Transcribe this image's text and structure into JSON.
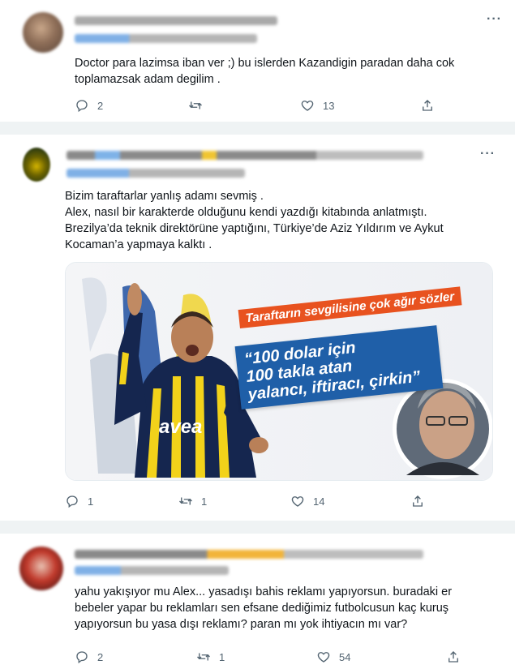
{
  "tweets": [
    {
      "text": "Doctor para lazimsa iban ver ;) bu islerden Kazandigin paradan daha cok\ntoplamazsak adam degilim .",
      "replies": "2",
      "retweets": "",
      "likes": "13"
    },
    {
      "text": "Bizim taraftarlar yanlış adamı sevmiş .\nAlex, nasıl bir karakterde olduğunu kendi yazdığı kitabında anlatmıştı.\nBrezilya’da teknik direktörüne yaptığını, Türkiye’de Aziz Yıldırım ve Aykut\nKocaman’a yapmaya kalktı .",
      "replies": "1",
      "retweets": "1",
      "likes": "14",
      "image": {
        "banner": "Taraftarın sevgilisine çok ağır sözler",
        "quote": "“100 dolar için\n100 takla atan\nyalancı, iftiracı, çirkin”",
        "jersey_text": "avea"
      }
    },
    {
      "text": "yahu yakışıyor mu Alex... yasadışı bahis reklamı yapıyorsun. buradaki er\nbebeler yapar bu reklamları sen efsane dediğimiz futbolcusun kaç kuruş\nyapıyorsun bu yasa dışı reklamı? paran mı yok ihtiyacın mı var?",
      "replies": "2",
      "retweets": "1",
      "likes": "54"
    }
  ],
  "icons": {
    "reply": "reply-icon",
    "retweet": "retweet-icon",
    "like": "heart-icon",
    "share": "share-icon",
    "more": "more-icon"
  },
  "colors": {
    "muted": "#536471",
    "separator": "#eff3f4",
    "banner": "#e8521f",
    "quote": "#1f5fa8"
  }
}
